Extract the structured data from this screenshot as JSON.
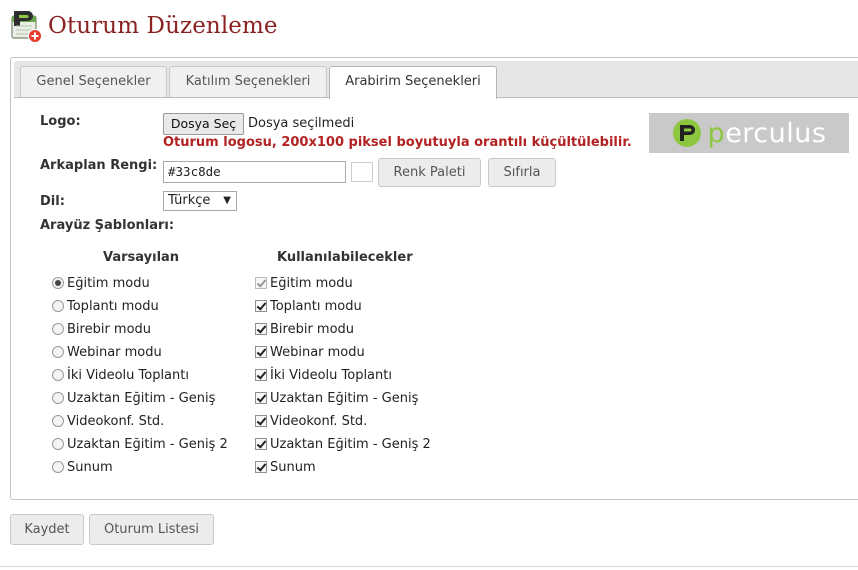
{
  "header": {
    "title": "Oturum Düzenleme"
  },
  "tabs": [
    {
      "label": "Genel Seçenekler",
      "active": false
    },
    {
      "label": "Katılım Seçenekleri",
      "active": false
    },
    {
      "label": "Arabirim Seçenekleri",
      "active": true
    }
  ],
  "form": {
    "logo_label": "Logo:",
    "file_button": "Dosya Seç",
    "file_status": "Dosya seçilmedi",
    "logo_hint": "Oturum logosu, 200x100 piksel boyutuyla orantılı küçültülebilir.",
    "logo_text": "erculus",
    "logo_letter": "p",
    "bg_color_label": "Arkaplan Rengi:",
    "bg_color_value": "#33c8de",
    "palette_button": "Renk Paleti",
    "reset_button": "Sıfırla",
    "language_label": "Dil:",
    "language_value": "Türkçe",
    "templates_label": "Arayüz Şablonları:"
  },
  "templates": {
    "default_header": "Varsayılan",
    "available_header": "Kullanılabilecekler",
    "items": [
      {
        "label": "Eğitim modu",
        "default": true,
        "available": true,
        "disabled": true
      },
      {
        "label": "Toplantı modu",
        "default": false,
        "available": true,
        "disabled": false
      },
      {
        "label": "Birebir modu",
        "default": false,
        "available": true,
        "disabled": false
      },
      {
        "label": "Webinar modu",
        "default": false,
        "available": true,
        "disabled": false
      },
      {
        "label": "İki Videolu Toplantı",
        "default": false,
        "available": true,
        "disabled": false
      },
      {
        "label": "Uzaktan Eğitim - Geniş",
        "default": false,
        "available": true,
        "disabled": false
      },
      {
        "label": "Videokonf. Std.",
        "default": false,
        "available": true,
        "disabled": false
      },
      {
        "label": "Uzaktan Eğitim - Geniş 2",
        "default": false,
        "available": true,
        "disabled": false
      },
      {
        "label": "Sunum",
        "default": false,
        "available": true,
        "disabled": false
      }
    ]
  },
  "footer": {
    "save_button": "Kaydet",
    "session_list_button": "Oturum Listesi"
  },
  "colors": {
    "title": "#8b2323",
    "hint": "#b22222",
    "logo_green": "#8dc63f"
  }
}
